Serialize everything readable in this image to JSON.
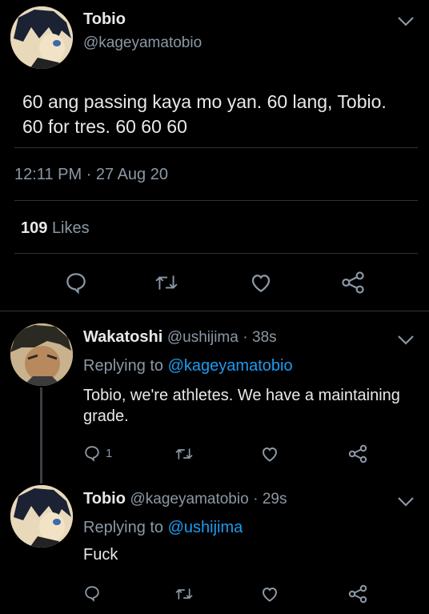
{
  "main_tweet": {
    "name": "Tobio",
    "handle": "@kageyamatobio",
    "text_line1": "60 ang passing kaya mo yan. 60 lang, Tobio.",
    "text_line2": "60 for tres. 60 60 60",
    "timestamp": "12:11 PM · 27 Aug 20",
    "likes_count": "109",
    "likes_label": "Likes"
  },
  "replies": [
    {
      "name": "Wakatoshi",
      "handle": "@ushijima",
      "time": "· 38s",
      "replying_prefix": "Replying to",
      "replying_to": "@kageyamatobio",
      "text_line1": "Tobio, we're athletes. We have a maintaining",
      "text_line2": "grade.",
      "reply_count": "1"
    },
    {
      "name": "Tobio",
      "handle": "@kageyamatobio",
      "time": "· 29s",
      "replying_prefix": "Replying to",
      "replying_to": "@ushijima",
      "text_line1": "Fuck"
    }
  ],
  "colors": {
    "background": "#000000",
    "text": "#d9d9d9",
    "muted": "#8b98a5",
    "link": "#1d9bf0",
    "divider": "#2f3336"
  },
  "icons": [
    "chevron-down-icon",
    "reply-icon",
    "retweet-icon",
    "like-icon",
    "share-icon"
  ]
}
